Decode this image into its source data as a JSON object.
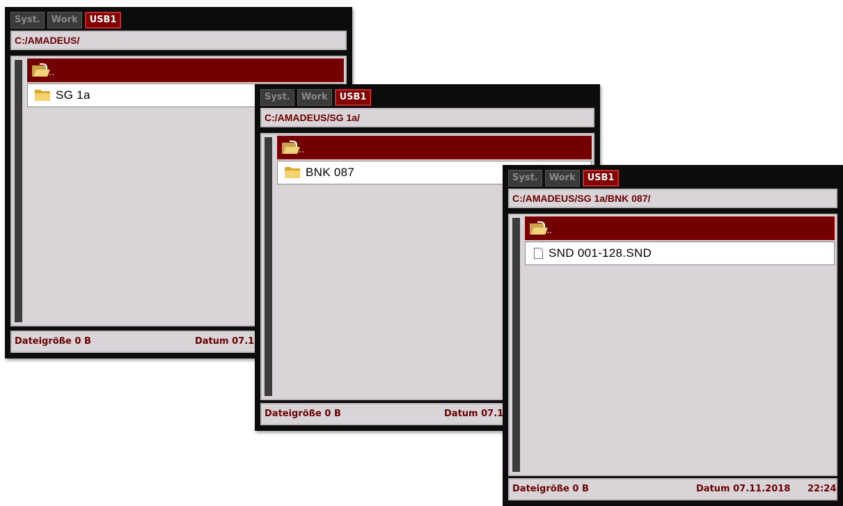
{
  "panels": [
    {
      "tabs": [
        "Syst.",
        "Work",
        "USB1"
      ],
      "active_tab": "USB1",
      "path": "C:/AMADEUS/",
      "up_label": "..",
      "item": {
        "label": "SG 1a",
        "icon": "folder-icon"
      },
      "status": {
        "size": "Dateigröße 0 B",
        "date": "Datum 07.1"
      }
    },
    {
      "tabs": [
        "Syst.",
        "Work",
        "USB1"
      ],
      "active_tab": "USB1",
      "path": "C:/AMADEUS/SG 1a/",
      "up_label": "..",
      "item": {
        "label": "BNK 087",
        "icon": "folder-icon"
      },
      "status": {
        "size": "Dateigröße 0 B",
        "date": "Datum 07.1"
      }
    },
    {
      "tabs": [
        "Syst.",
        "Work",
        "USB1"
      ],
      "active_tab": "USB1",
      "path": "C:/AMADEUS/SG 1a/BNK 087/",
      "up_label": "..",
      "item": {
        "label": "SND 001-128.SND",
        "icon": "file-icon"
      },
      "status": {
        "size": "Dateigröße 0 B",
        "date": "Datum 07.11.2018",
        "time": "22:24"
      }
    }
  ],
  "colors": {
    "accent": "#730000",
    "tab_active_border": "#cc2a2a",
    "panel_bg": "#d8d4d8",
    "arrow": "#4a7cc0"
  }
}
